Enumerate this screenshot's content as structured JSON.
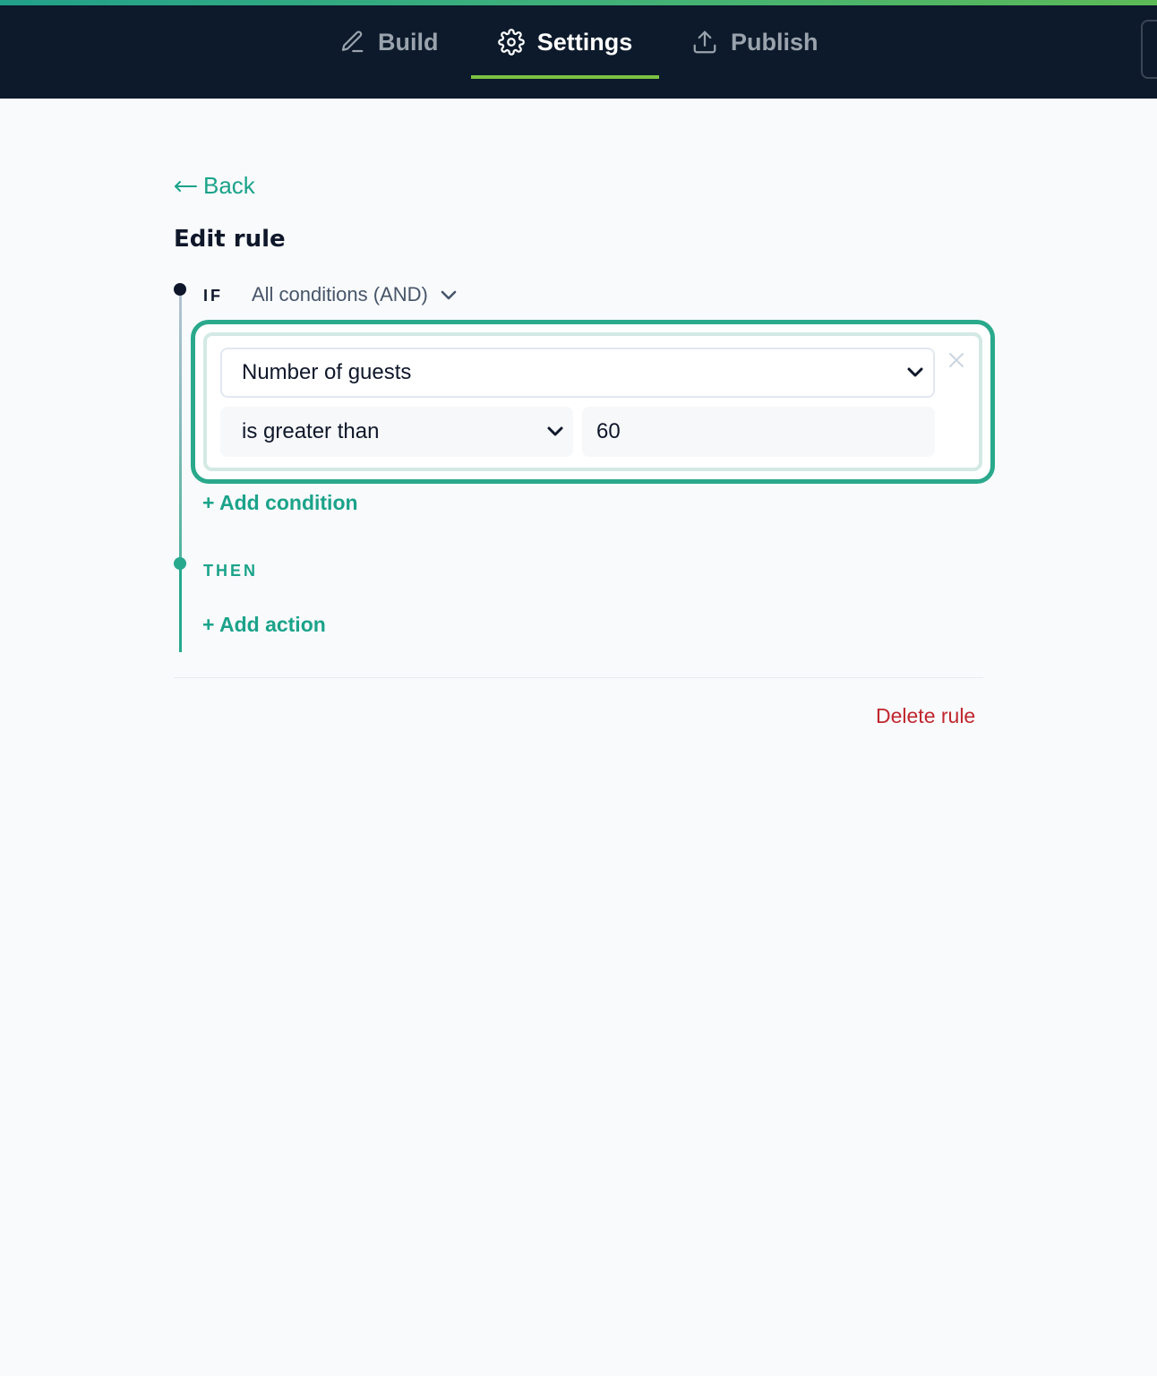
{
  "nav": {
    "tabs": [
      {
        "label": "Build",
        "icon": "pencil-icon"
      },
      {
        "label": "Settings",
        "icon": "gear-icon",
        "active": true
      },
      {
        "label": "Publish",
        "icon": "upload-icon"
      }
    ]
  },
  "page": {
    "back_label": "Back",
    "title": "Edit rule"
  },
  "rule": {
    "if_label": "IF",
    "conjunction": "All conditions (AND)",
    "condition": {
      "field": "Number of guests",
      "operator": "is greater than",
      "value": "60"
    },
    "add_condition_label": "+ Add condition",
    "then_label": "THEN",
    "add_action_label": "+ Add action",
    "delete_label": "Delete rule"
  },
  "colors": {
    "accent": "#1ba38a",
    "nav_bg": "#0c1a2b",
    "active_underline": "#7cc242",
    "danger": "#c0262d"
  }
}
